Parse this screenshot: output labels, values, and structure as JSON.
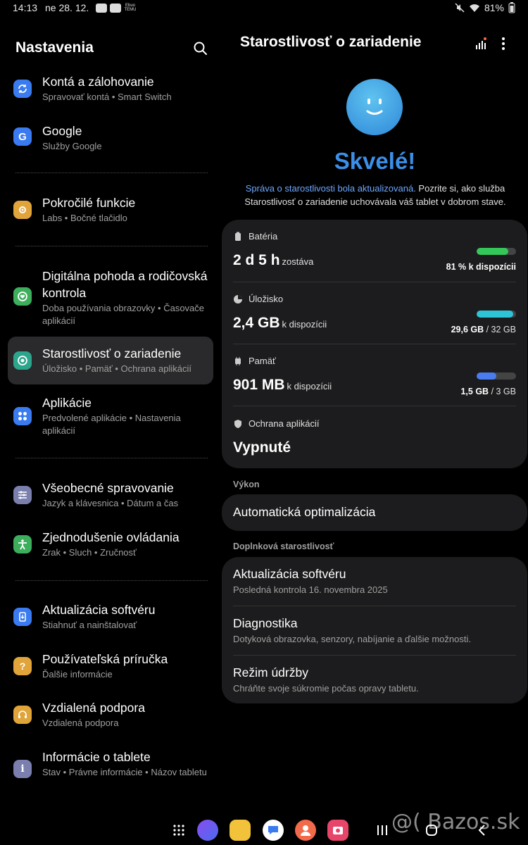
{
  "status_bar": {
    "time": "14:13",
    "date": "ne 28. 12.",
    "battery": "81%",
    "temu_label": "Ebuo TEMU"
  },
  "left": {
    "title": "Nastavenia",
    "items": [
      {
        "title": "Kontá a zálohovanie",
        "subtitle": "Spravovať kontá  •  Smart Switch",
        "icon": "sync-icon",
        "color": "#3a7bf0"
      },
      {
        "title": "Google",
        "subtitle": "Služby Google",
        "icon": "google-icon",
        "color": "#3a7bf0"
      },
      {
        "title": "Pokročilé funkcie",
        "subtitle": "Labs  •  Bočné tlačidlo",
        "icon": "advanced-features-icon",
        "color": "#e0a43a"
      },
      {
        "title": "Digitálna pohoda a rodičovská kontrola",
        "subtitle": "Doba používania obrazovky  •  Časovače aplikácií",
        "icon": "wellbeing-icon",
        "color": "#3cae5c"
      },
      {
        "title": "Starostlivosť o zariadenie",
        "subtitle": "Úložisko  •  Pamäť  •  Ochrana aplikácií",
        "icon": "device-care-icon",
        "color": "#2ca58d"
      },
      {
        "title": "Aplikácie",
        "subtitle": "Predvolené aplikácie  •  Nastavenia aplikácií",
        "icon": "apps-icon",
        "color": "#3a7bf0"
      },
      {
        "title": "Všeobecné spravovanie",
        "subtitle": "Jazyk a klávesnica  •  Dátum a čas",
        "icon": "general-management-icon",
        "color": "#7a7fae"
      },
      {
        "title": "Zjednodušenie ovládania",
        "subtitle": "Zrak  •  Sluch  •  Zručnosť",
        "icon": "accessibility-icon",
        "color": "#3cae5c"
      },
      {
        "title": "Aktualizácia softvéru",
        "subtitle": "Stiahnuť a nainštalovať",
        "icon": "software-update-icon",
        "color": "#3a7bf0"
      },
      {
        "title": "Používateľská príručka",
        "subtitle": "Ďalšie informácie",
        "icon": "user-manual-icon",
        "color": "#e0a43a"
      },
      {
        "title": "Vzdialená podpora",
        "subtitle": "Vzdialená podpora",
        "icon": "remote-support-icon",
        "color": "#e0a43a"
      },
      {
        "title": "Informácie o tablete",
        "subtitle": "Stav  •  Právne informácie  •  Názov tabletu",
        "icon": "info-icon",
        "color": "#7a7fae"
      }
    ]
  },
  "right": {
    "title": "Starostlivosť o zariadenie",
    "status_heading": "Skvelé!",
    "summary_link": "Správa o starostlivosti bola aktualizovaná.",
    "summary_text": " Pozrite si, ako služba Starostlivosť o zariadenie uchovávala váš tablet v dobrom stave.",
    "stats": {
      "battery": {
        "label": "Batéria",
        "value": "2 d 5 h",
        "unit": "zostáva",
        "note": "81 % k dispozícii",
        "fill": 0.81,
        "color": "#34c759"
      },
      "storage": {
        "label": "Úložisko",
        "value": "2,4 GB",
        "unit": "k dispozícii",
        "note_used": "29,6 GB",
        "note_total": " / 32 GB",
        "fill": 0.92,
        "color": "#2ec4d6"
      },
      "memory": {
        "label": "Pamäť",
        "value": "901 MB",
        "unit": "k dispozícii",
        "note_used": "1,5 GB",
        "note_total": " / 3 GB",
        "fill": 0.5,
        "color": "#4a7cf0"
      },
      "protection": {
        "label": "Ochrana aplikácií",
        "value": "Vypnuté"
      }
    },
    "performance_section": "Výkon",
    "auto_optimization": "Automatická optimalizácia",
    "additional_section": "Doplnková starostlivosť",
    "additional": [
      {
        "title": "Aktualizácia softvéru",
        "subtitle": "Posledná kontrola 16. novembra 2025"
      },
      {
        "title": "Diagnostika",
        "subtitle": "Dotyková obrazovka, senzory, nabíjanie a ďalšie možnosti."
      },
      {
        "title": "Režim údržby",
        "subtitle": "Chráňte svoje súkromie počas opravy tabletu."
      }
    ]
  },
  "watermark": "@( Bazos.sk"
}
